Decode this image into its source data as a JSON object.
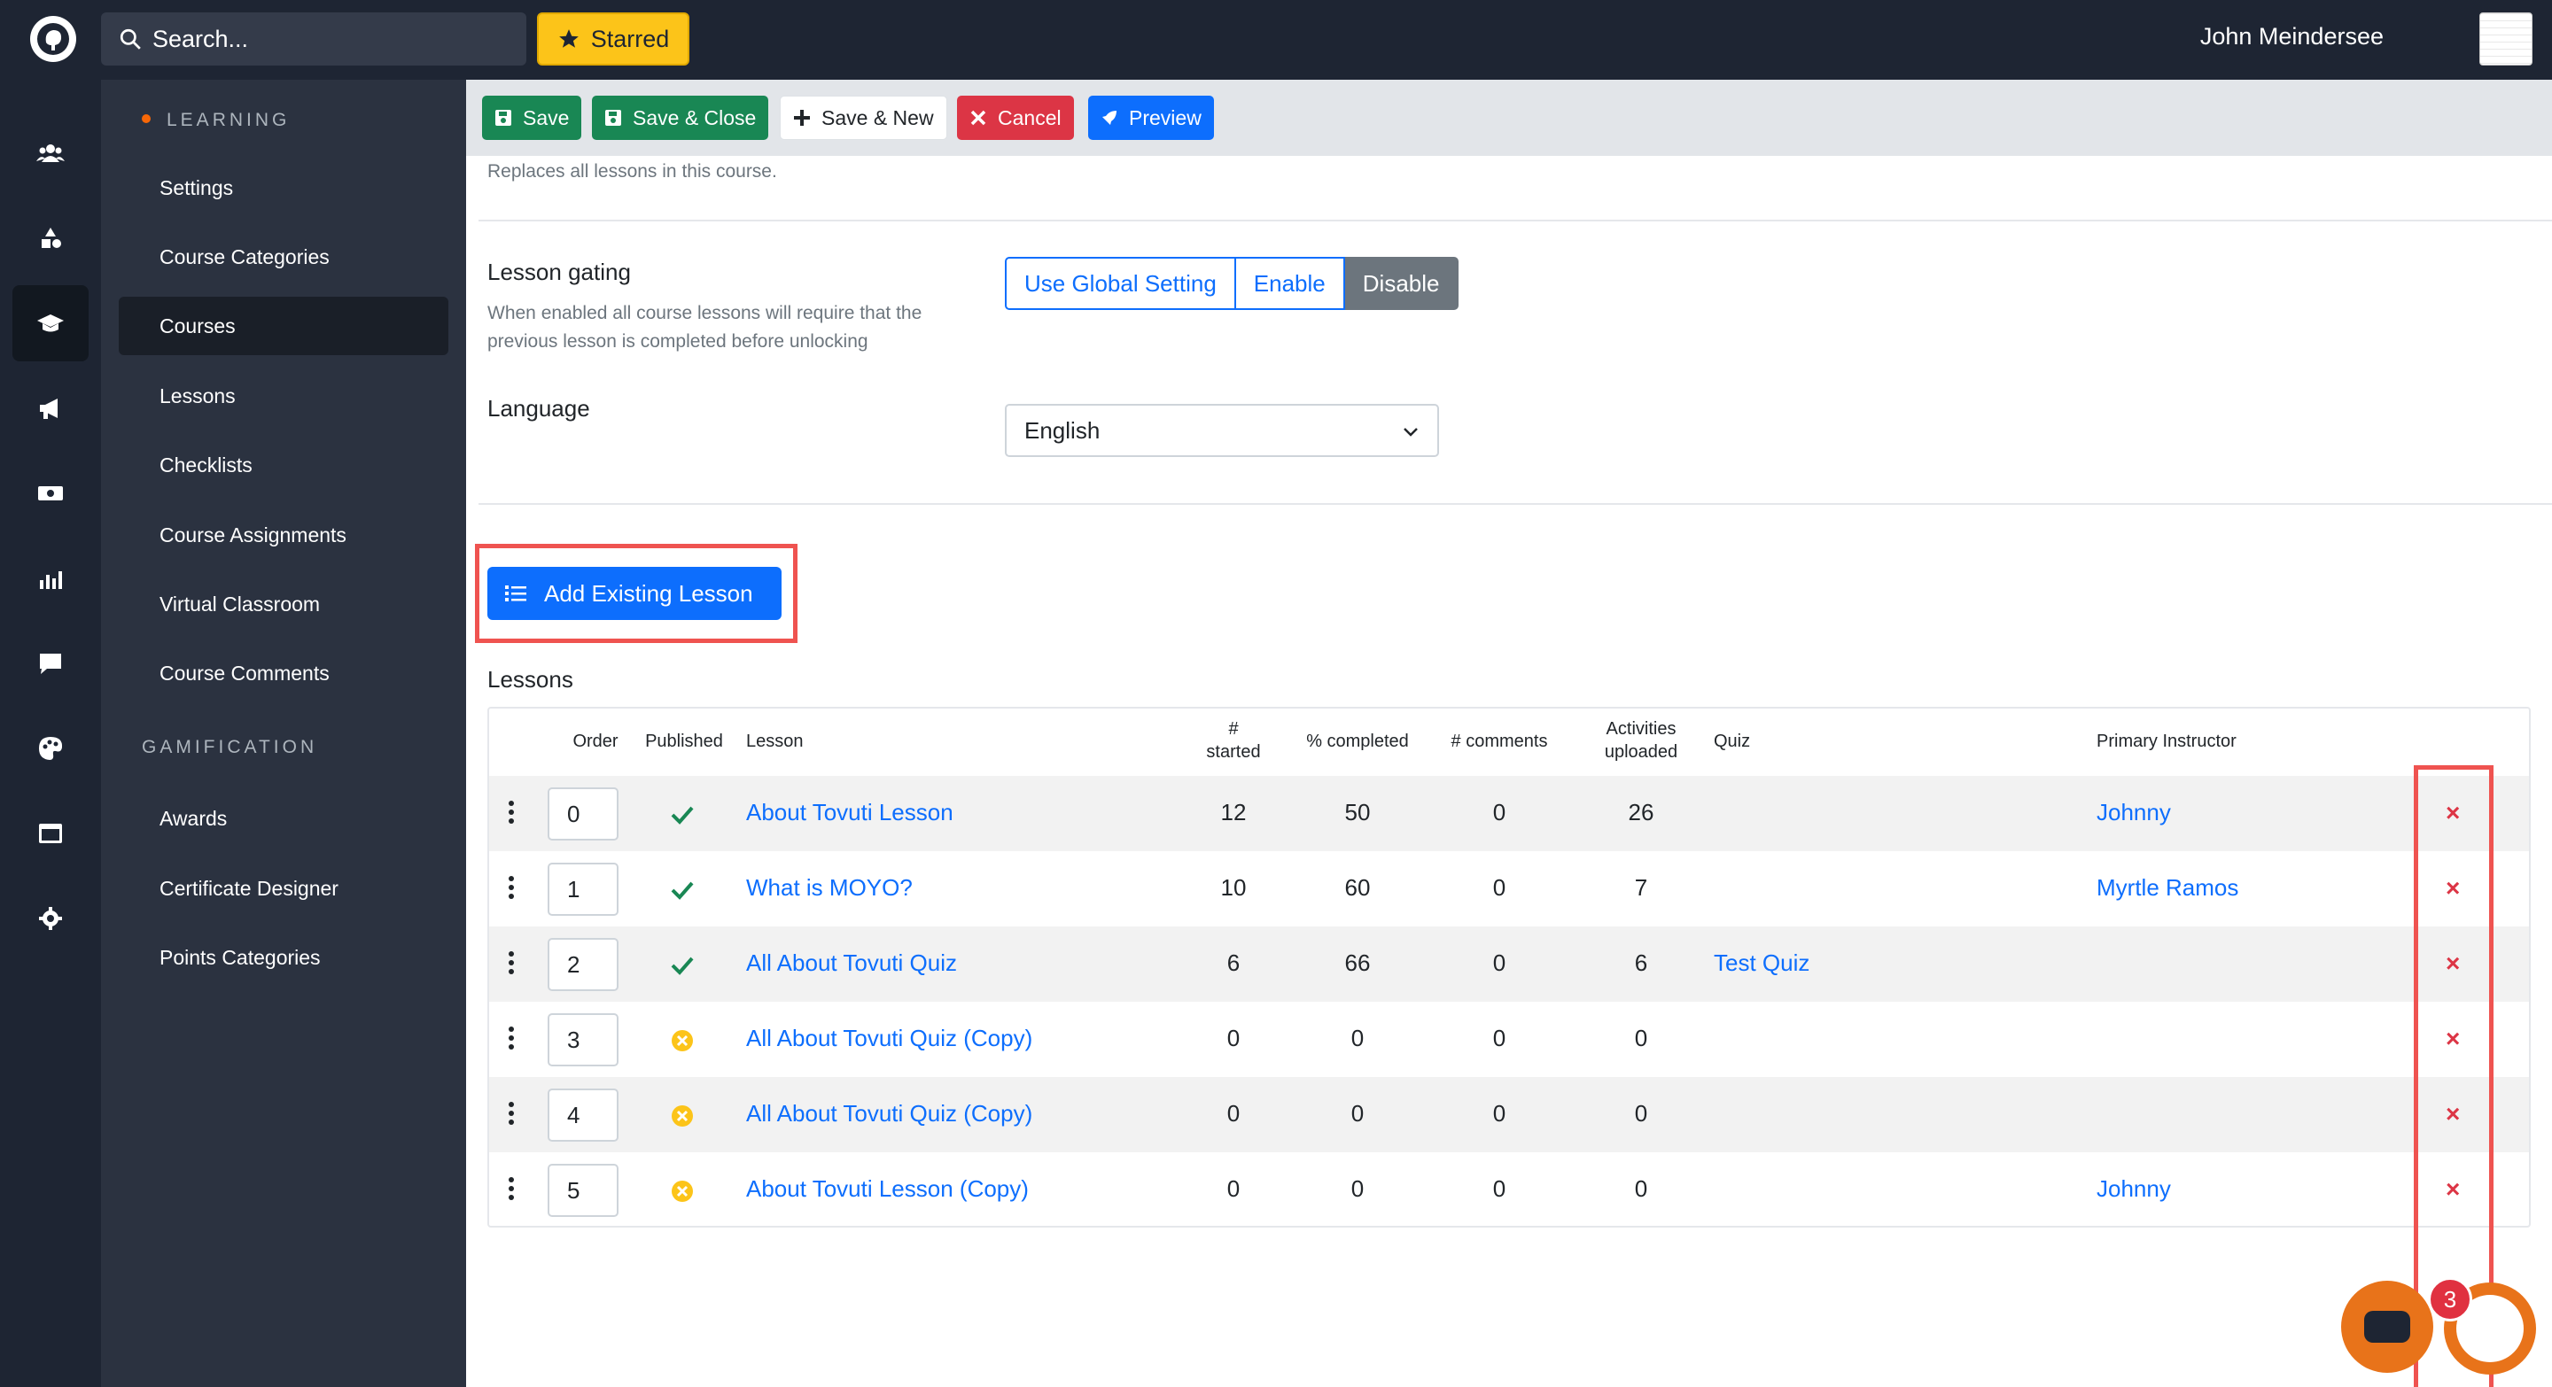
{
  "topbar": {
    "search_placeholder": "Search...",
    "starred_label": "Starred",
    "user_name": "John Meindersee"
  },
  "rail": {
    "icons": [
      "users-icon",
      "shapes-icon",
      "graduation-cap-icon",
      "megaphone-icon",
      "money-icon",
      "chart-icon",
      "comment-icon",
      "palette-icon",
      "window-icon",
      "gear-icon"
    ],
    "active": "graduation-cap-icon"
  },
  "sidebar": {
    "section_learning": "LEARNING",
    "learning_items": [
      "Settings",
      "Course Categories",
      "Courses",
      "Lessons",
      "Checklists",
      "Course Assignments",
      "Virtual Classroom",
      "Course Comments"
    ],
    "active_item": "Courses",
    "section_gamification": "GAMIFICATION",
    "gamification_items": [
      "Awards",
      "Certificate Designer",
      "Points Categories"
    ]
  },
  "toolbar": {
    "save": "Save",
    "save_close": "Save & Close",
    "save_new": "Save & New",
    "cancel": "Cancel",
    "preview": "Preview"
  },
  "form": {
    "replaces_note": "Replaces all lessons in this course.",
    "lesson_gating_label": "Lesson gating",
    "lesson_gating_help_1": "When enabled all course lessons will require that the",
    "lesson_gating_help_2": "previous lesson is completed before unlocking",
    "gating_options": [
      "Use Global Setting",
      "Enable",
      "Disable"
    ],
    "gating_selected": "Disable",
    "language_label": "Language",
    "language_value": "English",
    "add_existing_lesson": "Add Existing Lesson",
    "lessons_heading": "Lessons"
  },
  "table": {
    "headers": {
      "order": "Order",
      "published": "Published",
      "lesson": "Lesson",
      "started_1": "#",
      "started_2": "started",
      "completed": "% completed",
      "comments": "# comments",
      "activities_1": "Activities",
      "activities_2": "uploaded",
      "quiz": "Quiz",
      "instructor": "Primary Instructor"
    },
    "rows": [
      {
        "order": "0",
        "published": "check",
        "lesson": "About Tovuti Lesson",
        "started": "12",
        "completed": "50",
        "comments": "0",
        "activities": "26",
        "quiz": "",
        "instructor": "Johnny"
      },
      {
        "order": "1",
        "published": "check",
        "lesson": "What is MOYO?",
        "started": "10",
        "completed": "60",
        "comments": "0",
        "activities": "7",
        "quiz": "",
        "instructor": "Myrtle Ramos"
      },
      {
        "order": "2",
        "published": "check",
        "lesson": "All About Tovuti Quiz",
        "started": "6",
        "completed": "66",
        "comments": "0",
        "activities": "6",
        "quiz": "Test Quiz",
        "instructor": ""
      },
      {
        "order": "3",
        "published": "unpublished",
        "lesson": "All About Tovuti Quiz (Copy)",
        "started": "0",
        "completed": "0",
        "comments": "0",
        "activities": "0",
        "quiz": "",
        "instructor": ""
      },
      {
        "order": "4",
        "published": "unpublished",
        "lesson": "All About Tovuti Quiz (Copy)",
        "started": "0",
        "completed": "0",
        "comments": "0",
        "activities": "0",
        "quiz": "",
        "instructor": ""
      },
      {
        "order": "5",
        "published": "unpublished",
        "lesson": "About Tovuti Lesson (Copy)",
        "started": "0",
        "completed": "0",
        "comments": "0",
        "activities": "0",
        "quiz": "",
        "instructor": "Johnny"
      }
    ],
    "remove_symbol": "×"
  },
  "chat": {
    "badge_count": "3"
  },
  "colors": {
    "primary": "#0d6efd",
    "success": "#198754",
    "danger": "#dc3545",
    "warning": "#fcc419",
    "dark_bg": "#1e2533",
    "highlight": "#ef5350"
  }
}
